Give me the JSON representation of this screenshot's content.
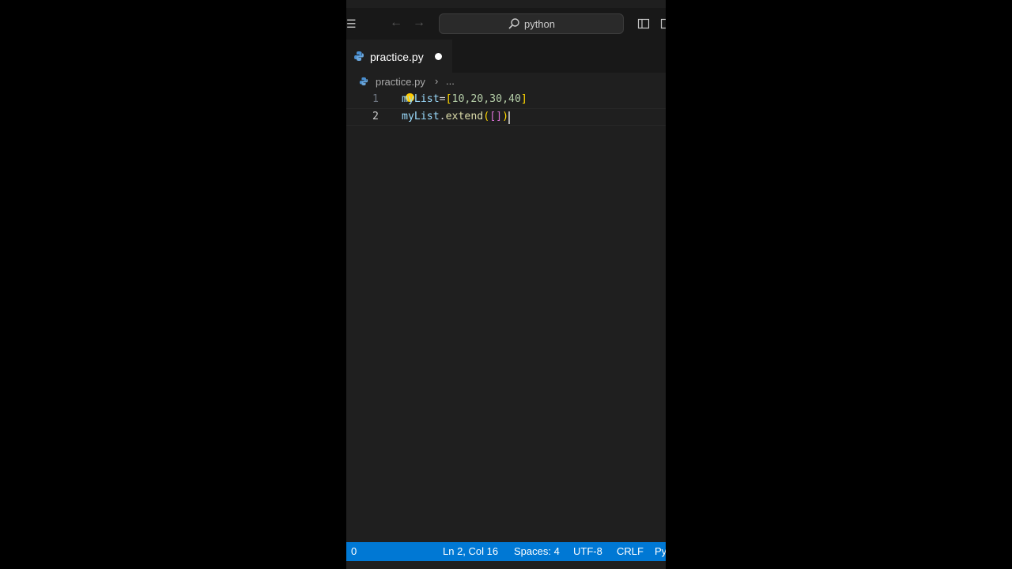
{
  "titlebar": {
    "search_text": "python"
  },
  "tab": {
    "label": "practice.py"
  },
  "breadcrumb": {
    "file": "practice.py",
    "more": "..."
  },
  "editor": {
    "lines": [
      {
        "number": "1",
        "tokens": [
          "myList",
          "=",
          "[",
          "10,20,30,40",
          "]"
        ]
      },
      {
        "number": "2",
        "tokens": [
          "myList",
          ".",
          "extend",
          "(",
          "[",
          "]",
          ")"
        ]
      }
    ]
  },
  "statusbar": {
    "problems": "0",
    "position": "Ln 2, Col 16",
    "spaces": "Spaces: 4",
    "encoding": "UTF-8",
    "eol": "CRLF",
    "language": "Py"
  },
  "colors": {
    "status_bar": "#0078d4",
    "editor_bg": "#1f1f1f",
    "titlebar_bg": "#181818"
  },
  "icons": [
    "menu-icon",
    "arrow-left-icon",
    "arrow-right-icon",
    "search-icon",
    "layout-sidebar-icon",
    "python-file-icon",
    "lightbulb-icon",
    "chevron-right-icon"
  ]
}
